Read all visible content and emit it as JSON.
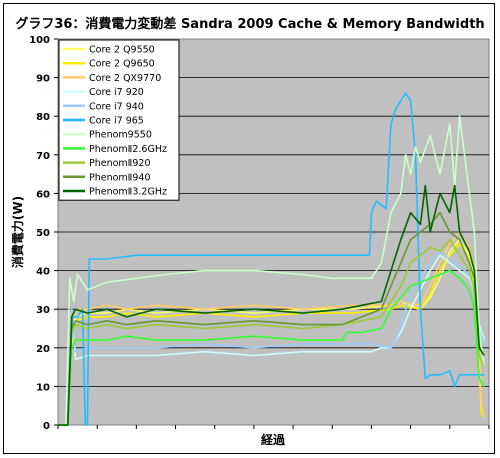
{
  "chart_data": {
    "type": "line",
    "title": "グラフ36：消費電力変動差 Sandra 2009 Cache & Memory Bandwidth",
    "xlabel": "経過",
    "ylabel": "消費電力(W)",
    "ylim": [
      0,
      100
    ],
    "yticks": [
      0,
      10,
      20,
      30,
      40,
      50,
      60,
      70,
      80,
      90,
      100
    ],
    "x_ticks_count": 11,
    "x_range": [
      0,
      440
    ],
    "grid": "horizontal",
    "legend_position": "top-left",
    "series": [
      {
        "name": "Core 2 Q9550",
        "color": "#ffff66",
        "values": [
          [
            0,
            0
          ],
          [
            10,
            0
          ],
          [
            15,
            25
          ],
          [
            18,
            28
          ],
          [
            30,
            29
          ],
          [
            50,
            29
          ],
          [
            70,
            30
          ],
          [
            100,
            29
          ],
          [
            150,
            30
          ],
          [
            200,
            29
          ],
          [
            250,
            30
          ],
          [
            300,
            30
          ],
          [
            340,
            31
          ],
          [
            350,
            32
          ],
          [
            370,
            30
          ],
          [
            380,
            33
          ],
          [
            390,
            38
          ],
          [
            400,
            45
          ],
          [
            410,
            48
          ],
          [
            420,
            44
          ],
          [
            425,
            38
          ],
          [
            430,
            20
          ],
          [
            432,
            5
          ],
          [
            435,
            3
          ]
        ]
      },
      {
        "name": "Core 2 Q9650",
        "color": "#ffee00",
        "values": [
          [
            0,
            0
          ],
          [
            10,
            0
          ],
          [
            15,
            24
          ],
          [
            18,
            27
          ],
          [
            30,
            28
          ],
          [
            50,
            28
          ],
          [
            70,
            29
          ],
          [
            100,
            28
          ],
          [
            150,
            29
          ],
          [
            200,
            28
          ],
          [
            250,
            29
          ],
          [
            300,
            29
          ],
          [
            340,
            30
          ],
          [
            350,
            31
          ],
          [
            370,
            30
          ],
          [
            380,
            34
          ],
          [
            390,
            40
          ],
          [
            400,
            44
          ],
          [
            410,
            47
          ],
          [
            420,
            43
          ],
          [
            425,
            36
          ],
          [
            430,
            15
          ],
          [
            432,
            3
          ],
          [
            435,
            2
          ]
        ]
      },
      {
        "name": "Core 2 QX9770",
        "color": "#ffcc66",
        "values": [
          [
            0,
            0
          ],
          [
            10,
            0
          ],
          [
            15,
            26
          ],
          [
            18,
            30
          ],
          [
            30,
            30
          ],
          [
            50,
            31
          ],
          [
            70,
            30
          ],
          [
            100,
            31
          ],
          [
            150,
            30
          ],
          [
            200,
            31
          ],
          [
            250,
            30
          ],
          [
            300,
            31
          ],
          [
            340,
            31
          ],
          [
            350,
            32
          ],
          [
            370,
            31
          ],
          [
            380,
            36
          ],
          [
            390,
            42
          ],
          [
            400,
            47
          ],
          [
            410,
            50
          ],
          [
            420,
            46
          ],
          [
            425,
            40
          ],
          [
            430,
            20
          ],
          [
            432,
            5
          ],
          [
            435,
            3
          ]
        ]
      },
      {
        "name": "Core i7 920",
        "color": "#ccffff",
        "values": [
          [
            0,
            0
          ],
          [
            10,
            0
          ],
          [
            14,
            30
          ],
          [
            18,
            17
          ],
          [
            30,
            18
          ],
          [
            50,
            18
          ],
          [
            70,
            18
          ],
          [
            100,
            18
          ],
          [
            150,
            19
          ],
          [
            200,
            18
          ],
          [
            250,
            19
          ],
          [
            300,
            19
          ],
          [
            320,
            19
          ],
          [
            330,
            20
          ],
          [
            340,
            20
          ],
          [
            345,
            22
          ],
          [
            350,
            24
          ],
          [
            360,
            30
          ],
          [
            370,
            35
          ],
          [
            380,
            40
          ],
          [
            390,
            44
          ],
          [
            400,
            42
          ],
          [
            410,
            40
          ],
          [
            420,
            38
          ],
          [
            425,
            35
          ],
          [
            430,
            26
          ],
          [
            435,
            22
          ]
        ]
      },
      {
        "name": "Core i7 940",
        "color": "#99ccff",
        "values": [
          [
            0,
            0
          ],
          [
            10,
            0
          ],
          [
            14,
            30
          ],
          [
            18,
            19
          ],
          [
            30,
            20
          ],
          [
            50,
            20
          ],
          [
            70,
            20
          ],
          [
            100,
            20
          ],
          [
            150,
            21
          ],
          [
            200,
            20
          ],
          [
            250,
            21
          ],
          [
            300,
            21
          ],
          [
            320,
            21
          ],
          [
            340,
            20
          ],
          [
            345,
            22
          ],
          [
            350,
            26
          ],
          [
            360,
            34
          ],
          [
            370,
            38
          ],
          [
            380,
            42
          ],
          [
            390,
            45
          ],
          [
            400,
            43
          ],
          [
            410,
            41
          ],
          [
            420,
            39
          ],
          [
            425,
            35
          ],
          [
            430,
            25
          ],
          [
            435,
            21
          ]
        ]
      },
      {
        "name": "Core i7 965",
        "color": "#22bbff",
        "values": [
          [
            0,
            0
          ],
          [
            10,
            0
          ],
          [
            12,
            16
          ],
          [
            15,
            28
          ],
          [
            20,
            28
          ],
          [
            25,
            30
          ],
          [
            28,
            0
          ],
          [
            30,
            0
          ],
          [
            32,
            43
          ],
          [
            36,
            43
          ],
          [
            50,
            43
          ],
          [
            80,
            44
          ],
          [
            110,
            44
          ],
          [
            150,
            44
          ],
          [
            200,
            44
          ],
          [
            250,
            44
          ],
          [
            300,
            44
          ],
          [
            318,
            44
          ],
          [
            320,
            55
          ],
          [
            325,
            58
          ],
          [
            330,
            57
          ],
          [
            335,
            56
          ],
          [
            340,
            78
          ],
          [
            345,
            82
          ],
          [
            350,
            84
          ],
          [
            355,
            86
          ],
          [
            360,
            84
          ],
          [
            365,
            70
          ],
          [
            370,
            30
          ],
          [
            375,
            12
          ],
          [
            380,
            13
          ],
          [
            390,
            13
          ],
          [
            400,
            14
          ],
          [
            405,
            10
          ],
          [
            410,
            13
          ],
          [
            420,
            13
          ],
          [
            430,
            13
          ],
          [
            435,
            13
          ]
        ]
      },
      {
        "name": "Phenom9550",
        "color": "#ccffcc",
        "values": [
          [
            0,
            0
          ],
          [
            8,
            0
          ],
          [
            12,
            38
          ],
          [
            16,
            32
          ],
          [
            20,
            39
          ],
          [
            30,
            35
          ],
          [
            50,
            37
          ],
          [
            80,
            38
          ],
          [
            110,
            39
          ],
          [
            150,
            40
          ],
          [
            200,
            40
          ],
          [
            250,
            39
          ],
          [
            280,
            38
          ],
          [
            300,
            38
          ],
          [
            320,
            38
          ],
          [
            330,
            42
          ],
          [
            340,
            55
          ],
          [
            350,
            60
          ],
          [
            355,
            70
          ],
          [
            360,
            65
          ],
          [
            365,
            72
          ],
          [
            370,
            68
          ],
          [
            380,
            75
          ],
          [
            390,
            65
          ],
          [
            400,
            78
          ],
          [
            405,
            62
          ],
          [
            410,
            80
          ],
          [
            415,
            70
          ],
          [
            420,
            60
          ],
          [
            425,
            50
          ],
          [
            430,
            25
          ],
          [
            435,
            15
          ]
        ]
      },
      {
        "name": "PhenomⅡ2.6GHz",
        "color": "#33ff33",
        "values": [
          [
            0,
            0
          ],
          [
            10,
            0
          ],
          [
            14,
            20
          ],
          [
            18,
            22
          ],
          [
            30,
            22
          ],
          [
            50,
            22
          ],
          [
            70,
            23
          ],
          [
            100,
            22
          ],
          [
            150,
            22
          ],
          [
            200,
            23
          ],
          [
            250,
            22
          ],
          [
            280,
            22
          ],
          [
            290,
            22
          ],
          [
            295,
            24
          ],
          [
            310,
            24
          ],
          [
            330,
            25
          ],
          [
            340,
            30
          ],
          [
            350,
            33
          ],
          [
            360,
            36
          ],
          [
            370,
            37
          ],
          [
            380,
            38
          ],
          [
            390,
            39
          ],
          [
            400,
            40
          ],
          [
            410,
            38
          ],
          [
            420,
            35
          ],
          [
            425,
            30
          ],
          [
            430,
            12
          ],
          [
            435,
            10
          ]
        ]
      },
      {
        "name": "PhenomⅡ920",
        "color": "#99cc33",
        "values": [
          [
            0,
            0
          ],
          [
            10,
            0
          ],
          [
            14,
            24
          ],
          [
            18,
            26
          ],
          [
            30,
            25
          ],
          [
            50,
            26
          ],
          [
            70,
            25
          ],
          [
            100,
            26
          ],
          [
            150,
            25
          ],
          [
            200,
            26
          ],
          [
            250,
            25
          ],
          [
            290,
            26
          ],
          [
            310,
            27
          ],
          [
            330,
            28
          ],
          [
            340,
            32
          ],
          [
            350,
            36
          ],
          [
            360,
            42
          ],
          [
            370,
            44
          ],
          [
            380,
            46
          ],
          [
            390,
            45
          ],
          [
            400,
            48
          ],
          [
            410,
            44
          ],
          [
            420,
            40
          ],
          [
            425,
            35
          ],
          [
            430,
            18
          ],
          [
            435,
            15
          ]
        ]
      },
      {
        "name": "PhenomⅡ940",
        "color": "#669933",
        "values": [
          [
            0,
            0
          ],
          [
            10,
            0
          ],
          [
            14,
            25
          ],
          [
            18,
            27
          ],
          [
            30,
            26
          ],
          [
            50,
            27
          ],
          [
            70,
            26
          ],
          [
            100,
            27
          ],
          [
            150,
            26
          ],
          [
            200,
            27
          ],
          [
            250,
            26
          ],
          [
            290,
            26
          ],
          [
            310,
            28
          ],
          [
            330,
            30
          ],
          [
            340,
            36
          ],
          [
            350,
            42
          ],
          [
            360,
            48
          ],
          [
            370,
            50
          ],
          [
            380,
            52
          ],
          [
            390,
            55
          ],
          [
            400,
            50
          ],
          [
            410,
            48
          ],
          [
            420,
            42
          ],
          [
            425,
            38
          ],
          [
            430,
            20
          ],
          [
            435,
            18
          ]
        ]
      },
      {
        "name": "PhenomⅡ3.2GHz",
        "color": "#006600",
        "values": [
          [
            0,
            0
          ],
          [
            10,
            0
          ],
          [
            14,
            28
          ],
          [
            18,
            30
          ],
          [
            30,
            29
          ],
          [
            50,
            30
          ],
          [
            70,
            28
          ],
          [
            100,
            30
          ],
          [
            150,
            29
          ],
          [
            200,
            30
          ],
          [
            250,
            29
          ],
          [
            290,
            30
          ],
          [
            310,
            31
          ],
          [
            330,
            32
          ],
          [
            340,
            40
          ],
          [
            350,
            48
          ],
          [
            360,
            55
          ],
          [
            370,
            52
          ],
          [
            375,
            62
          ],
          [
            380,
            50
          ],
          [
            390,
            60
          ],
          [
            400,
            55
          ],
          [
            405,
            62
          ],
          [
            410,
            50
          ],
          [
            420,
            45
          ],
          [
            425,
            40
          ],
          [
            430,
            20
          ],
          [
            435,
            18
          ]
        ]
      }
    ]
  }
}
